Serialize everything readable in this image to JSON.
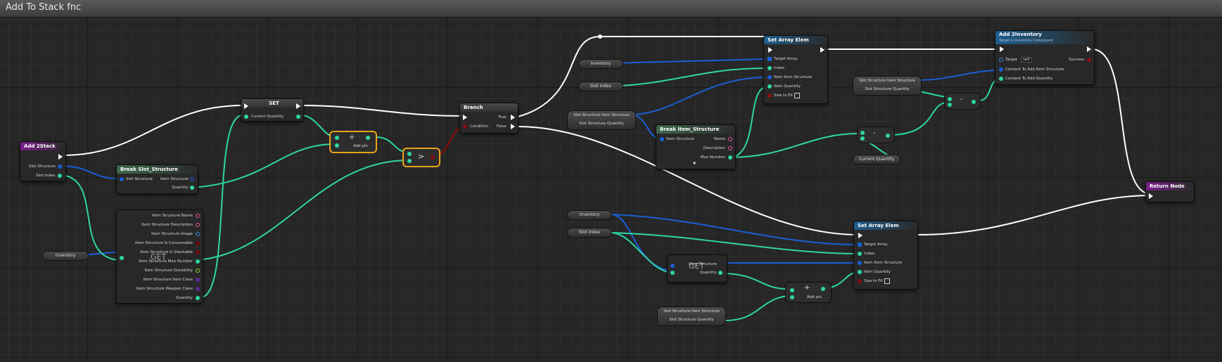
{
  "window": {
    "title": "Add To Stack fnc"
  },
  "nodes": {
    "entry": {
      "title": "Add 2Stack",
      "pins": [
        "Slot Structure",
        "Slot Index"
      ]
    },
    "break_slot": {
      "title": "Break Slot_Structure",
      "in": "Slot Structure",
      "out1": "Item Structure",
      "out2": "Quantity"
    },
    "set": {
      "title": "SET",
      "pin": "Current Quantity"
    },
    "add_mid": {
      "label": "Add pin",
      "symbol": "+"
    },
    "greater": {
      "symbol": ">"
    },
    "branch": {
      "title": "Branch",
      "cond": "Condition",
      "true": "True",
      "false": "False"
    },
    "get_array": {
      "label": "GET",
      "pins": [
        "Item Structure Name",
        "Item Structure Description",
        "Item Structure Image",
        "Item Structure Is Consumable",
        "Item Structure Is Stackable",
        "Item Structure Max Number",
        "Item Structure Durability",
        "Item Structure Item Class",
        "Item Structure Weapon Class",
        "Quantity"
      ]
    },
    "set_array_top": {
      "title": "Set Array Elem",
      "pins": [
        "Target Array",
        "Index",
        "Item Item Structure",
        "Item Quantity",
        "Size to Fit"
      ]
    },
    "break_item": {
      "title": "Break Item_Structure",
      "in": "Item Structure",
      "outs": [
        "Name",
        "Description",
        "Max Number"
      ]
    },
    "minus1": {
      "symbol": "-"
    },
    "minus2": {
      "symbol": "-"
    },
    "add_inventory": {
      "title": "Add 2Inventory",
      "subtitle": "Target is Inventory Component",
      "target": "Target",
      "target_val": "self",
      "success": "Success",
      "pins": [
        "Content To Add Item Structure",
        "Content To Add Quantity"
      ]
    },
    "return": {
      "title": "Return Node"
    },
    "set_array_bottom": {
      "title": "Set Array Elem",
      "pins": [
        "Target Array",
        "Index",
        "Item Item Structure",
        "Item Quantity",
        "Size to Fit"
      ]
    },
    "get2": {
      "label": "GET",
      "pins": [
        "Item Structure",
        "Quantity"
      ]
    },
    "add_bottom": {
      "label": "Add pin",
      "symbol": "+"
    }
  },
  "vars": {
    "inventory_left": "Inventory",
    "inventory_top": "Inventory",
    "slot_index_top": "Slot Index",
    "slot_struct_top": "Slot Structure Item Structure",
    "slot_qty_top": "Slot Structure Quantity",
    "slot_struct_right": "Slot Structure Item Structure",
    "slot_qty_right": "Slot Structure Quantity",
    "current_qty": "Current Quantity",
    "inventory_bottom": "Inventory",
    "slot_index_bottom": "Slot Index",
    "slot_struct_bottom": "Slot Structure Item Structure",
    "slot_qty_bottom": "Slot Structure Quantity"
  },
  "colors": {
    "exec": "#ffffff",
    "struct": "#1a5fd6",
    "int": "#2fd6a6",
    "bool": "#8a0c0c",
    "select_outline": "#e8a21c"
  }
}
